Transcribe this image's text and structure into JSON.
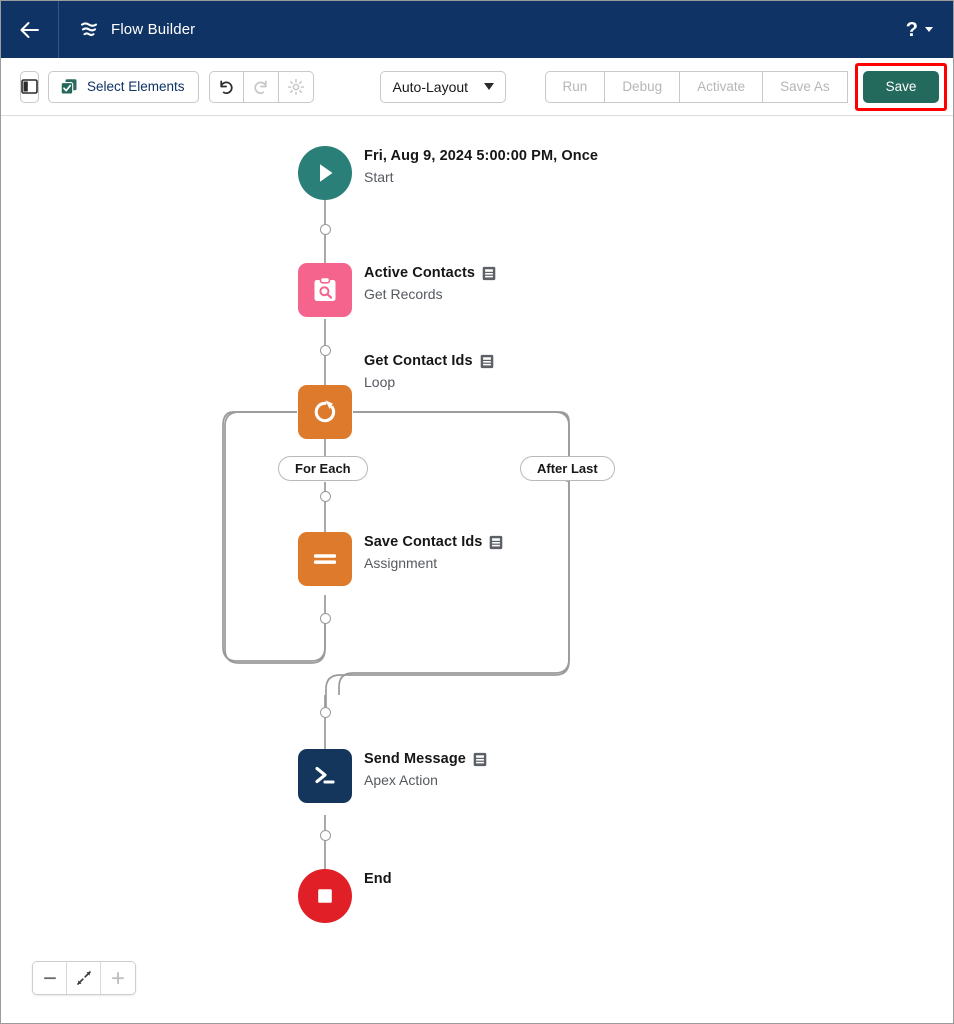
{
  "header": {
    "back_icon": "arrow-left-icon",
    "logo_icon": "flow-builder-logo-icon",
    "title": "Flow Builder",
    "help_label": "?",
    "help_icon": "help-icon",
    "background": "#0f3364"
  },
  "toolbar": {
    "panel_toggle_icon": "toggle-left-panel-icon",
    "select_elements_label": "Select Elements",
    "select_elements_icon": "select-elements-icon",
    "undo_icon": "undo-icon",
    "redo_icon": "redo-icon",
    "settings_icon": "gear-icon",
    "layout_label": "Auto-Layout",
    "run_label": "Run",
    "debug_label": "Debug",
    "activate_label": "Activate",
    "save_as_label": "Save As",
    "save_label": "Save",
    "save_color": "#23695c",
    "highlight_color": "#ff0000"
  },
  "canvas": {
    "nodes": [
      {
        "id": "start",
        "title": "Fri, Aug 9, 2024 5:00:00 PM, Once",
        "subtitle": "Start",
        "icon": "play-icon",
        "color": "#2a8078",
        "has_badge": false
      },
      {
        "id": "get-records",
        "title": "Active Contacts",
        "subtitle": "Get Records",
        "icon": "get-records-icon",
        "color": "#f5648d",
        "has_badge": true
      },
      {
        "id": "loop",
        "title": "Get Contact Ids",
        "subtitle": "Loop",
        "icon": "loop-icon",
        "color": "#dd7a2b",
        "has_badge": true
      },
      {
        "id": "assignment",
        "title": "Save Contact Ids",
        "subtitle": "Assignment",
        "icon": "assignment-icon",
        "color": "#dd7a2b",
        "has_badge": true
      },
      {
        "id": "apex-action",
        "title": "Send Message",
        "subtitle": "Apex Action",
        "icon": "apex-action-icon",
        "color": "#14365d",
        "has_badge": true
      },
      {
        "id": "end",
        "title": "End",
        "subtitle": "",
        "icon": "stop-icon",
        "color": "#e01f27",
        "has_badge": false
      }
    ],
    "branches": [
      {
        "id": "for-each",
        "label": "For Each"
      },
      {
        "id": "after-last",
        "label": "After Last"
      }
    ],
    "connector_color": "#9a9a9a"
  },
  "zoom_controls": {
    "zoom_out_icon": "minus-icon",
    "fit_icon": "fit-to-view-icon",
    "zoom_in_icon": "plus-icon"
  }
}
